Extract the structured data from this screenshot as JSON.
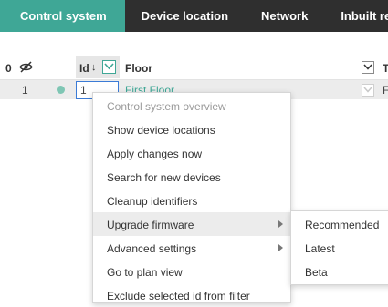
{
  "tabs": [
    {
      "label": "Control system",
      "active": true
    },
    {
      "label": "Device location",
      "active": false
    },
    {
      "label": "Network",
      "active": false
    },
    {
      "label": "Inbuilt rela",
      "active": false
    }
  ],
  "table": {
    "header": {
      "count": "0",
      "id_label": "Id",
      "sort_icon": "↓",
      "floor_label": "Floor",
      "t_label": "T"
    },
    "row": {
      "number": "1",
      "id_value": "1",
      "floor": "First Floor",
      "f_value": "F"
    }
  },
  "context_menu": {
    "items": [
      {
        "label": "Control system overview"
      },
      {
        "label": "Show device locations"
      },
      {
        "label": "Apply changes now"
      },
      {
        "label": "Search for new devices"
      },
      {
        "label": "Cleanup identifiers"
      },
      {
        "label": "Upgrade firmware"
      },
      {
        "label": "Advanced settings"
      },
      {
        "label": "Go to plan view"
      },
      {
        "label": "Exclude selected id from filter"
      }
    ],
    "submenu": {
      "items": [
        {
          "label": "Recommended"
        },
        {
          "label": "Latest"
        },
        {
          "label": "Beta"
        }
      ]
    }
  },
  "colors": {
    "accent": "#3fa796",
    "tabbar": "#2f2f2f",
    "selection_border": "#3b7bd6"
  }
}
